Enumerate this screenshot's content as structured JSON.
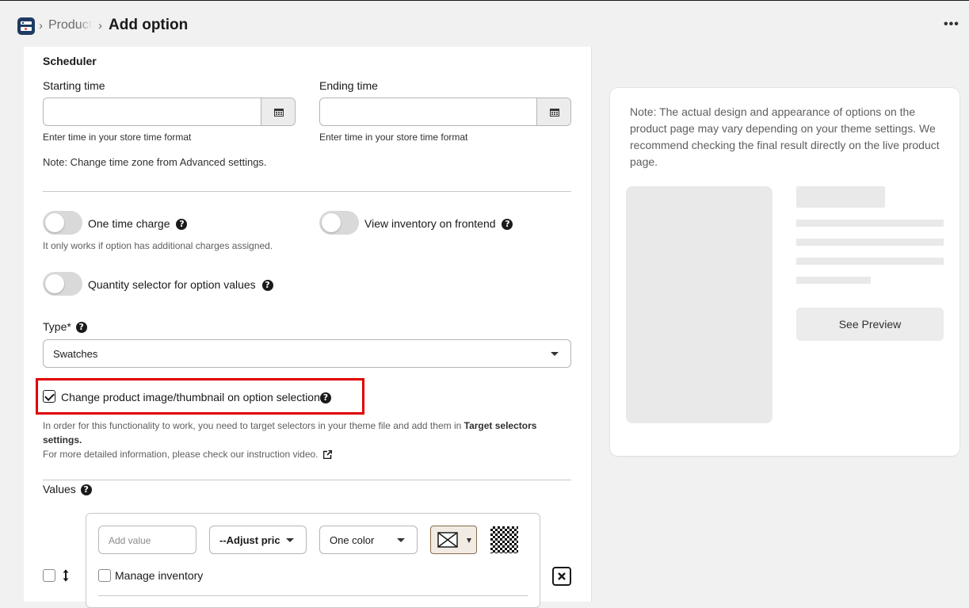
{
  "header": {
    "breadcrumb_parent": "Product",
    "page_title": "Add option",
    "more_label": "•••"
  },
  "scheduler": {
    "title": "Scheduler",
    "starting_time_label": "Starting time",
    "ending_time_label": "Ending time",
    "start_help": "Enter time in your store time format",
    "end_help": "Enter time in your store time format",
    "tz_note": "Note: Change time zone from Advanced settings."
  },
  "toggles": {
    "one_time_charge": "One time charge",
    "one_time_help": "It only works if option has additional charges assigned.",
    "view_inventory": "View inventory on frontend",
    "quantity_selector": "Quantity selector for option values"
  },
  "type": {
    "label": "Type*",
    "selected": "Swatches"
  },
  "change_image": {
    "label": "Change product image/thumbnail on option selection",
    "checked": true,
    "help_1": "In order for this functionality to work, you need to target selectors in your theme file and add them in ",
    "help_1_bold": "Target selectors settings.",
    "help_2": "For more detailed information, please check our instruction video."
  },
  "values": {
    "label": "Values",
    "add_value_placeholder": "Add value",
    "adjust_price": "--Adjust pric",
    "color_mode": "One color",
    "manage_inventory": "Manage inventory"
  },
  "preview": {
    "note": "Note: The actual design and appearance of options on the product page may vary depending on your theme settings. We recommend checking the final result directly on the live product page.",
    "see_preview": "See Preview"
  },
  "colors": {
    "highlight": "#e00000",
    "toggle_off": "#d9d9d9",
    "brand": "#1f3a63"
  }
}
